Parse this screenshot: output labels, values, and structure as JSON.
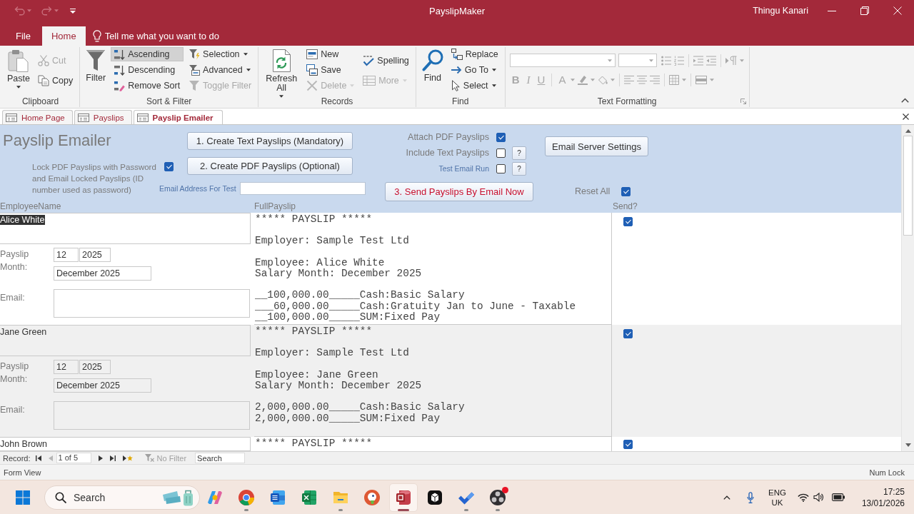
{
  "window": {
    "title": "PayslipMaker",
    "user": "Thingu Kanari"
  },
  "quick_access": [
    {
      "kind": "undo",
      "disabled": true
    },
    {
      "kind": "redo",
      "disabled": true
    }
  ],
  "ribbon": {
    "tabs": [
      {
        "label": "File",
        "selected": false
      },
      {
        "label": "Home",
        "selected": true
      }
    ],
    "tell_me": {
      "placeholder": "Tell me what you want to do"
    },
    "groups": [
      {
        "kind": "commands",
        "label": "Clipboard",
        "commands": [
          {
            "label": "Paste",
            "kind": "large-menu",
            "disabled": false
          },
          {
            "label": "Cut",
            "kind": "small",
            "disabled": true
          },
          {
            "label": "Copy",
            "kind": "small",
            "disabled": false
          }
        ]
      },
      {
        "kind": "commands",
        "label": "Sort & Filter",
        "commands": [
          {
            "label": "Filter",
            "kind": "large",
            "disabled": false,
            "on": false
          },
          {
            "label": "Ascending",
            "kind": "small",
            "disabled": false,
            "on": true
          },
          {
            "label": "Descending",
            "kind": "small",
            "disabled": false,
            "on": false
          },
          {
            "label": "Remove Sort",
            "kind": "small",
            "disabled": false,
            "on": false
          },
          {
            "label": "Selection",
            "kind": "small-menu",
            "disabled": false,
            "on": false
          },
          {
            "label": "Advanced",
            "kind": "small-menu",
            "disabled": false,
            "on": false
          },
          {
            "label": "Toggle Filter",
            "kind": "small",
            "disabled": true,
            "on": false
          }
        ]
      },
      {
        "kind": "commands",
        "label": "Records",
        "commands": [
          {
            "label": "Refresh All",
            "kind": "large-menu",
            "disabled": false
          },
          {
            "label": "New",
            "kind": "small",
            "disabled": false
          },
          {
            "label": "Save",
            "kind": "small",
            "disabled": false
          },
          {
            "label": "Delete",
            "kind": "small-menu",
            "disabled": true
          },
          {
            "label": "Spelling",
            "kind": "small",
            "disabled": false
          },
          {
            "label": "More",
            "kind": "small-menu",
            "disabled": true
          }
        ]
      },
      {
        "kind": "commands",
        "label": "Find",
        "commands": [
          {
            "label": "Find",
            "kind": "large",
            "disabled": false
          },
          {
            "label": "Replace",
            "kind": "small",
            "disabled": false
          },
          {
            "label": "Go To",
            "kind": "small-menu",
            "disabled": false
          },
          {
            "label": "Select",
            "kind": "small-menu",
            "disabled": false
          }
        ]
      },
      {
        "kind": "formatting",
        "label": "Text Formatting",
        "disabled": true,
        "glyphs": [
          "B",
          "I",
          "U",
          "A"
        ]
      }
    ]
  },
  "document_tabs": [
    {
      "label": "Home Page",
      "selected": false
    },
    {
      "label": "Payslips",
      "selected": false
    },
    {
      "label": "Payslip Emailer",
      "selected": true
    }
  ],
  "form": {
    "title": "Payslip Emailer",
    "create_text_button": {
      "label": "1. Create Text Payslips (Mandatory)"
    },
    "create_pdf_button": {
      "label": "2. Create PDF Payslips (Optional)"
    },
    "lock_pdf": {
      "label": "Lock PDF Payslips with Password and Email Locked Payslips (ID number used as password)",
      "checked": true
    },
    "test_email_address": {
      "label": "Email Address For Test"
    },
    "attach_pdf": {
      "label": "Attach PDF Payslips",
      "checked": true
    },
    "include_text": {
      "label": "Include Text Payslips",
      "checked": false,
      "help": "?"
    },
    "test_email_run": {
      "label": "Test Email Run",
      "checked": false,
      "help": "?"
    },
    "send_button": {
      "label": "3. Send Payslips By Email Now"
    },
    "server_settings_button": {
      "label": "Email Server Settings"
    },
    "reset_all": {
      "label": "Reset All",
      "checked": true
    },
    "columns": [
      "EmployeeName",
      "FullPayslip",
      "Send?"
    ],
    "records": [
      {
        "name": "Alice White",
        "selected": true,
        "month_label": "Payslip Month:",
        "month": "12",
        "year": "2025",
        "period": "December 2025",
        "email_label": "Email:",
        "payslip": "***** PAYSLIP *****\n\nEmployer: Sample Test Ltd\n\nEmployee: Alice White\nSalary Month: December 2025\n\n__100,000.00_____Cash:Basic Salary\n___60,000.00_____Cash:Gratuity Jan to June - Taxable\n__100,000.00_____SUM:Fixed Pay",
        "send": true
      },
      {
        "name": "Jane Green",
        "selected": false,
        "month_label": "Payslip Month:",
        "month": "12",
        "year": "2025",
        "period": "December 2025",
        "email_label": "Email:",
        "payslip": "***** PAYSLIP *****\n\nEmployer: Sample Test Ltd\n\nEmployee: Jane Green\nSalary Month: December 2025\n\n2,000,000.00_____Cash:Basic Salary\n2,000,000.00_____SUM:Fixed Pay",
        "send": true
      },
      {
        "name": "John Brown",
        "selected": false,
        "payslip": "***** PAYSLIP *****",
        "send": true
      }
    ]
  },
  "record_nav": {
    "label": "Record:",
    "buttons": [
      {
        "kind": "first",
        "disabled": false
      },
      {
        "kind": "previous",
        "disabled": true
      },
      {
        "kind": "next",
        "disabled": false
      },
      {
        "kind": "last",
        "disabled": false
      },
      {
        "kind": "new",
        "disabled": false
      }
    ],
    "position": "1 of 5",
    "filter": {
      "label": "No Filter",
      "filtered": false
    },
    "search": {
      "placeholder": "Search"
    }
  },
  "status_bar": {
    "view": "Form View",
    "indicators": [
      "Num Lock"
    ]
  },
  "taskbar": {
    "search": {
      "placeholder": "Search"
    },
    "apps": [
      {
        "running": false,
        "selected": false,
        "notification": false
      },
      {
        "running": true,
        "selected": false,
        "notification": false
      },
      {
        "running": false,
        "selected": false,
        "notification": false
      },
      {
        "running": false,
        "selected": false,
        "notification": false
      },
      {
        "running": true,
        "selected": false,
        "notification": false
      },
      {
        "running": false,
        "selected": false,
        "notification": false
      },
      {
        "running": true,
        "selected": true,
        "notification": false
      },
      {
        "running": false,
        "selected": false,
        "notification": false
      },
      {
        "running": true,
        "selected": false,
        "notification": false
      },
      {
        "running": true,
        "selected": false,
        "notification": true
      }
    ],
    "tray": {
      "language": "ENG",
      "region": "UK",
      "time": "17:25",
      "date": "13/01/2026"
    }
  }
}
